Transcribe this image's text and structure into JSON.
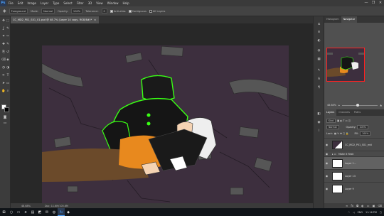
{
  "app": {
    "logo": "Ps",
    "window_controls": [
      "—",
      "❐",
      "✕"
    ]
  },
  "menu": [
    "File",
    "Edit",
    "Image",
    "Layer",
    "Type",
    "Select",
    "Filter",
    "3D",
    "View",
    "Window",
    "Help"
  ],
  "options": {
    "brush_preset": "Foreground",
    "mode_label": "Mode:",
    "mode_value": "Normal",
    "opacity_label": "Opacity:",
    "opacity_value": "100%",
    "tolerance_label": "Tolerance:",
    "tolerance_value": "0",
    "antialias_label": "Anti-alias",
    "contiguous_label": "Contiguous",
    "all_layers_label": "All Layers"
  },
  "document": {
    "tab_title": "CC_MD2_P01_S01_01.psd @ 48.7% (Layer 14 copy, RGB/8#)*",
    "close": "×"
  },
  "status": {
    "zoom": "48.68%",
    "doc_size": "Doc: 11.6M/105.6M"
  },
  "tools": [
    "move-tool",
    "marquee-tool",
    "lasso-tool",
    "quick-select-tool",
    "crop-tool",
    "eyedropper-tool",
    "healing-tool",
    "brush-tool",
    "clone-stamp-tool",
    "history-brush-tool",
    "eraser-tool",
    "paint-bucket-tool",
    "blur-tool",
    "dodge-tool",
    "pen-tool",
    "type-tool",
    "path-select-tool",
    "rectangle-tool",
    "hand-tool",
    "zoom-tool"
  ],
  "colors": {
    "foreground": "#ffffff",
    "background": "#000000",
    "accent_green": "#39ff14",
    "canvas_bg": "#3d2f3e",
    "orange": "#e8891e"
  },
  "panels": {
    "top_tabs": [
      "Histogram",
      "Navigator"
    ],
    "navigator_zoom": "48.68%",
    "layer_tabs": [
      "Layers",
      "Channels",
      "Paths"
    ],
    "kind": "Kind",
    "blend": "Normal",
    "opacity_label": "Opacity:",
    "opacity_value": "100%",
    "lock_label": "Lock:",
    "fill_label": "Fill:",
    "fill_value": "100%",
    "layers": [
      {
        "name": "CC_MD2_P01_S01_mkl",
        "type": "layer"
      },
      {
        "name": "Make it flesh",
        "type": "folder"
      },
      {
        "name": "Layer 1...",
        "type": "layer"
      },
      {
        "name": "Layer 13",
        "type": "layer"
      },
      {
        "name": "Layer 9",
        "type": "layer"
      }
    ]
  },
  "taskbar": {
    "tray_lang": "ENG",
    "time": "11:16 PM"
  }
}
